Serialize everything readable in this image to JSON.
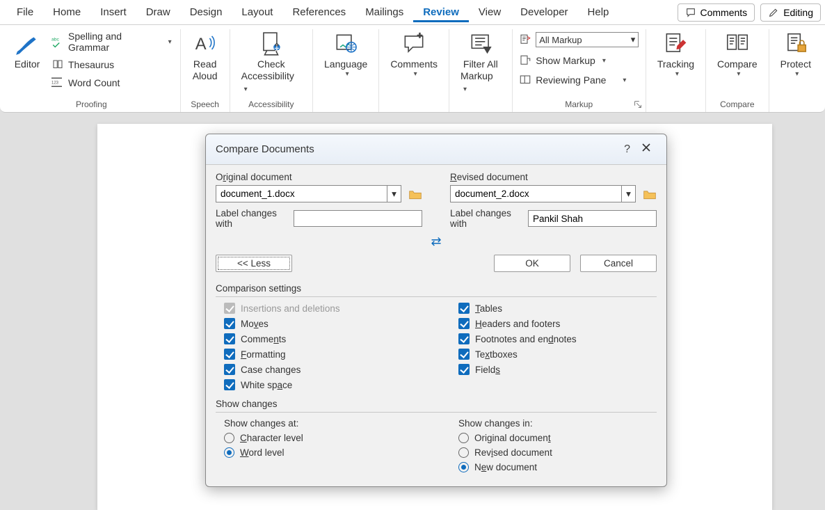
{
  "menubar": {
    "items": [
      "File",
      "Home",
      "Insert",
      "Draw",
      "Design",
      "Layout",
      "References",
      "Mailings",
      "Review",
      "View",
      "Developer",
      "Help"
    ],
    "active": "Review",
    "comments_btn": "Comments",
    "editing_btn": "Editing"
  },
  "ribbon": {
    "proofing": {
      "label": "Proofing",
      "editor": "Editor",
      "spelling": "Spelling and Grammar",
      "thesaurus": "Thesaurus",
      "wordcount": "Word Count"
    },
    "speech": {
      "label": "Speech",
      "read1": "Read",
      "read2": "Aloud"
    },
    "accessibility": {
      "label": "Accessibility",
      "check1": "Check",
      "check2": "Accessibility"
    },
    "language": {
      "label": "Language"
    },
    "comments": {
      "label": "Comments"
    },
    "filter": {
      "line1": "Filter All",
      "line2": "Markup"
    },
    "markup": {
      "label": "Markup",
      "combo": "All Markup",
      "show": "Show Markup",
      "pane": "Reviewing Pane"
    },
    "tracking": {
      "label": "Tracking"
    },
    "compare": {
      "label": "Compare",
      "btn": "Compare"
    },
    "protect": {
      "label": "Protect"
    }
  },
  "dialog": {
    "title": "Compare Documents",
    "help": "?",
    "original_label_pre": "O",
    "original_label_u": "r",
    "original_label_post": "iginal document",
    "revised_label_pre": "",
    "revised_label_u": "R",
    "revised_label_post": "evised document",
    "original_value": "document_1.docx",
    "revised_value": "document_2.docx",
    "label_changes": "Label changes with",
    "original_author": "",
    "revised_author": "Pankil Shah",
    "less_btn": "<< Less",
    "ok": "OK",
    "cancel": "Cancel",
    "comparison_head": "Comparison settings",
    "checks_left": [
      {
        "label": "Insertions and deletions",
        "checked": true,
        "disabled": true
      },
      {
        "pre": "Mo",
        "u": "v",
        "post": "es",
        "checked": true
      },
      {
        "pre": "Comme",
        "u": "n",
        "post": "ts",
        "checked": true
      },
      {
        "pre": "",
        "u": "F",
        "post": "ormatting",
        "checked": true
      },
      {
        "pre": "Case chan",
        "u": "g",
        "post": "es",
        "checked": true
      },
      {
        "pre": "White sp",
        "u": "a",
        "post": "ce",
        "checked": true
      }
    ],
    "checks_right": [
      {
        "pre": "",
        "u": "T",
        "post": "ables",
        "checked": true
      },
      {
        "pre": "",
        "u": "H",
        "post": "eaders and footers",
        "checked": true
      },
      {
        "pre": "Footnotes and en",
        "u": "d",
        "post": "notes",
        "checked": true
      },
      {
        "pre": "Te",
        "u": "x",
        "post": "tboxes",
        "checked": true
      },
      {
        "pre": "Field",
        "u": "s",
        "post": "",
        "checked": true
      }
    ],
    "show_head": "Show changes",
    "show_at": "Show changes at:",
    "show_in": "Show changes in:",
    "radios_at": [
      {
        "pre": "",
        "u": "C",
        "post": "haracter level",
        "sel": false
      },
      {
        "pre": "",
        "u": "W",
        "post": "ord level",
        "sel": true
      }
    ],
    "radios_in": [
      {
        "pre": "Original documen",
        "u": "t",
        "post": "",
        "sel": false
      },
      {
        "pre": "Rev",
        "u": "i",
        "post": "sed document",
        "sel": false
      },
      {
        "pre": "N",
        "u": "e",
        "post": "w document",
        "sel": true
      }
    ]
  }
}
